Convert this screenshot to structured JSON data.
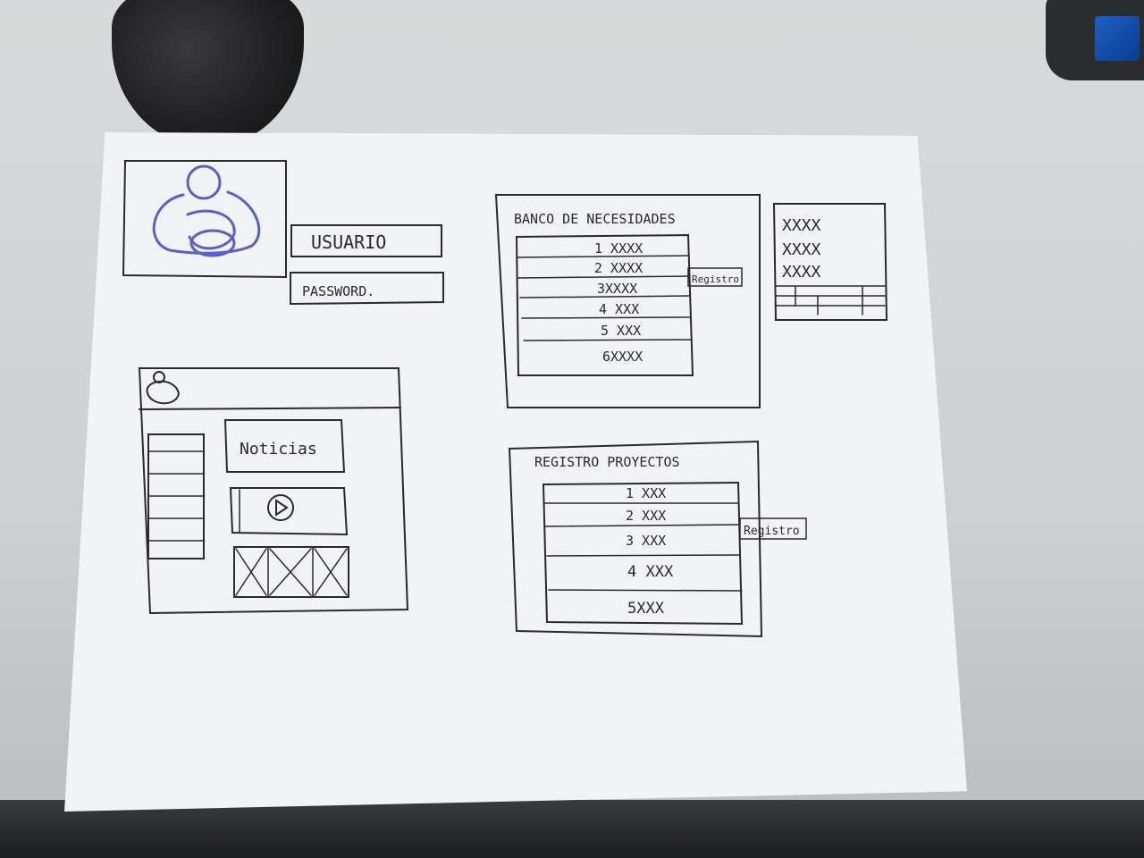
{
  "login": {
    "user_label": "USUARIO",
    "password_label": "PASSWORD."
  },
  "dashboard": {
    "news_label": "Noticias"
  },
  "needs_bank": {
    "title": "BANCO DE NECESIDADES",
    "rows": [
      "1 XXXX",
      "2 XXXX",
      "3XXXX",
      "4 XXX",
      "5 XXX",
      "6XXXX"
    ],
    "register_button": "Registro"
  },
  "projects": {
    "title": "REGISTRO PROYECTOS",
    "rows": [
      "1 XXX",
      "2 XXX",
      "3 XXX",
      "4 XXX",
      "5XXX"
    ],
    "register_button": "Registro"
  },
  "side_panel": {
    "rows": [
      "XXXX",
      "XXXX",
      "XXXX"
    ]
  },
  "colors": {
    "ink": "#2a2a2e",
    "logo_ink": "#5b5fc7"
  }
}
